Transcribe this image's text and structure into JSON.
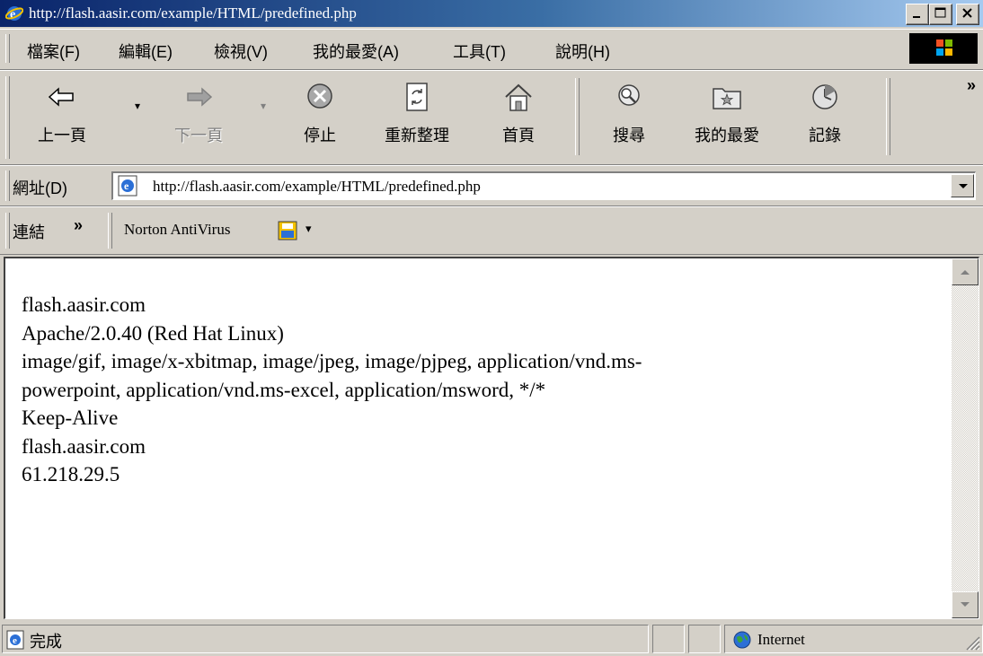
{
  "window": {
    "title": "http://flash.aasir.com/example/HTML/predefined.php",
    "buttons": [
      "minimize-icon",
      "maximize-icon",
      "close-icon"
    ]
  },
  "menu": {
    "items": [
      "檔案(F)",
      "編輯(E)",
      "檢視(V)",
      "我的最愛(A)",
      "工具(T)",
      "說明(H)"
    ]
  },
  "toolbar": {
    "back": "上一頁",
    "forward": "下一頁",
    "stop": "停止",
    "refresh": "重新整理",
    "home": "首頁",
    "search": "搜尋",
    "favorites": "我的最愛",
    "history": "記錄",
    "more": "»"
  },
  "address": {
    "label": "網址(D)",
    "url": "http://flash.aasir.com/example/HTML/predefined.php"
  },
  "links": {
    "label": "連結",
    "more": "»",
    "norton": "Norton AntiVirus"
  },
  "content": {
    "lines": [
      "flash.aasir.com",
      "Apache/2.0.40 (Red Hat Linux)",
      "image/gif, image/x-xbitmap, image/jpeg, image/pjpeg, application/vnd.ms-",
      "powerpoint, application/vnd.ms-excel, application/msword, */*",
      "Keep-Alive",
      "flash.aasir.com",
      "61.218.29.5"
    ]
  },
  "status": {
    "text": "完成",
    "zone": "Internet"
  },
  "colors": {
    "titlebar_start": "#0a246a",
    "titlebar_end": "#a6caf0",
    "chrome": "#d4d0c8"
  }
}
